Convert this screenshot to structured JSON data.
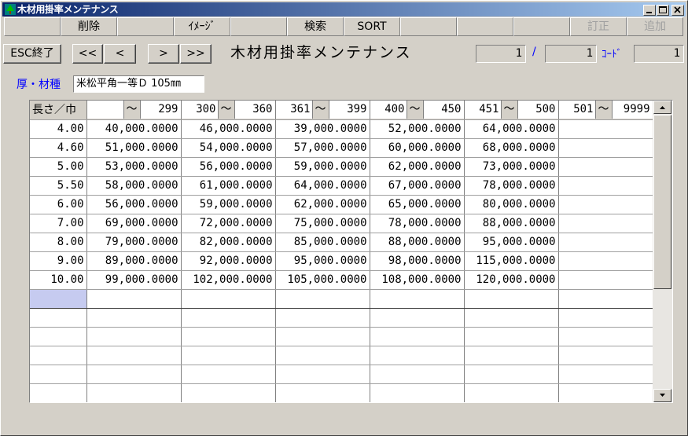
{
  "window": {
    "title": "木材用掛率メンテナンス"
  },
  "fkeys": [
    {
      "label": ""
    },
    {
      "label": "削除"
    },
    {
      "label": ""
    },
    {
      "label": "ｲﾒｰｼﾞ"
    },
    {
      "label": ""
    },
    {
      "label": "検索"
    },
    {
      "label": "SORT"
    },
    {
      "label": ""
    },
    {
      "label": ""
    },
    {
      "label": ""
    },
    {
      "label": "訂正"
    },
    {
      "label": "追加"
    }
  ],
  "nav": {
    "esc_label": "ESC終了",
    "first_label": "<<",
    "prev_label": "<",
    "next_label": ">",
    "last_label": ">>"
  },
  "screen_title": "木材用掛率メンテナンス",
  "paging": {
    "current": "1",
    "sep": "/",
    "total": "1",
    "code_label": "ｺｰﾄﾞ",
    "code": "1"
  },
  "material": {
    "label": "厚・材種",
    "value": "米松平角一等Ｄ 105㎜"
  },
  "grid": {
    "corner_label": "長さ／巾",
    "columns": [
      {
        "from": "",
        "tilde": "～",
        "to": "299"
      },
      {
        "from": "300",
        "tilde": "～",
        "to": "360"
      },
      {
        "from": "361",
        "tilde": "～",
        "to": "399"
      },
      {
        "from": "400",
        "tilde": "～",
        "to": "450"
      },
      {
        "from": "451",
        "tilde": "～",
        "to": "500"
      },
      {
        "from": "501",
        "tilde": "～",
        "to": "9999"
      }
    ],
    "rows": [
      {
        "length": "4.00",
        "values": [
          "40,000.0000",
          "46,000.0000",
          "39,000.0000",
          "52,000.0000",
          "64,000.0000",
          ""
        ]
      },
      {
        "length": "4.60",
        "values": [
          "51,000.0000",
          "54,000.0000",
          "57,000.0000",
          "60,000.0000",
          "68,000.0000",
          ""
        ]
      },
      {
        "length": "5.00",
        "values": [
          "53,000.0000",
          "56,000.0000",
          "59,000.0000",
          "62,000.0000",
          "73,000.0000",
          ""
        ]
      },
      {
        "length": "5.50",
        "values": [
          "58,000.0000",
          "61,000.0000",
          "64,000.0000",
          "67,000.0000",
          "78,000.0000",
          ""
        ]
      },
      {
        "length": "6.00",
        "values": [
          "56,000.0000",
          "59,000.0000",
          "62,000.0000",
          "65,000.0000",
          "80,000.0000",
          ""
        ]
      },
      {
        "length": "7.00",
        "values": [
          "69,000.0000",
          "72,000.0000",
          "75,000.0000",
          "78,000.0000",
          "88,000.0000",
          ""
        ]
      },
      {
        "length": "8.00",
        "values": [
          "79,000.0000",
          "82,000.0000",
          "85,000.0000",
          "88,000.0000",
          "95,000.0000",
          ""
        ]
      },
      {
        "length": "9.00",
        "values": [
          "89,000.0000",
          "92,000.0000",
          "95,000.0000",
          "98,000.0000",
          "115,000.0000",
          ""
        ]
      },
      {
        "length": "10.00",
        "values": [
          "99,000.0000",
          "102,000.0000",
          "105,000.0000",
          "108,000.0000",
          "120,000.0000",
          ""
        ]
      },
      {
        "length": "",
        "values": [
          "",
          "",
          "",
          "",
          "",
          ""
        ]
      },
      {
        "length": "",
        "values": [
          "",
          "",
          "",
          "",
          "",
          ""
        ]
      },
      {
        "length": "",
        "values": [
          "",
          "",
          "",
          "",
          "",
          ""
        ]
      },
      {
        "length": "",
        "values": [
          "",
          "",
          "",
          "",
          "",
          ""
        ]
      },
      {
        "length": "",
        "values": [
          "",
          "",
          "",
          "",
          "",
          ""
        ]
      },
      {
        "length": "",
        "values": [
          "",
          "",
          "",
          "",
          "",
          ""
        ]
      }
    ]
  },
  "colors": {
    "title_active": "#0a246a",
    "selection": "#c6cbf0",
    "label_blue": "#0000ff",
    "face": "#d4d0c8"
  }
}
